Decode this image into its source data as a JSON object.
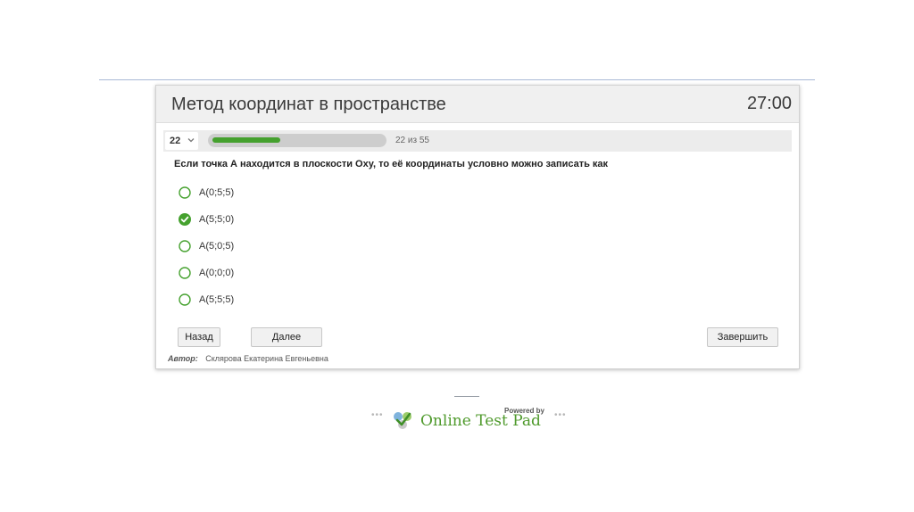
{
  "quiz": {
    "title": "Метод координат в пространстве",
    "timer": "27:00",
    "question_number": "22",
    "progress_text": "22 из 55",
    "progress_fraction": 0.4,
    "question": "Если точка А находится в плоскости Oxy, то её координаты условно можно записать как",
    "options": [
      {
        "label": "A(0;5;5)",
        "selected": false
      },
      {
        "label": "A(5;5;0)",
        "selected": true
      },
      {
        "label": "A(5;0;5)",
        "selected": false
      },
      {
        "label": "A(0;0;0)",
        "selected": false
      },
      {
        "label": "A(5;5;5)",
        "selected": false
      }
    ],
    "buttons": {
      "back": "Назад",
      "next": "Далее",
      "finish": "Завершить"
    },
    "author_label": "Автор:",
    "author_name": "Склярова Екатерина Евгеньевна"
  },
  "footer": {
    "dots_left": "•••",
    "dots_right": "•••",
    "powered_by": "Powered by",
    "brand": "Online Test Pad"
  },
  "colors": {
    "accent": "#45a12e",
    "brand": "#4f9a2c"
  },
  "icons": {
    "question_select": "chevron-down-icon",
    "selected_option": "check-circle-icon",
    "unselected_option": "radio-circle-icon",
    "logo": "online-test-pad-logo-icon"
  }
}
